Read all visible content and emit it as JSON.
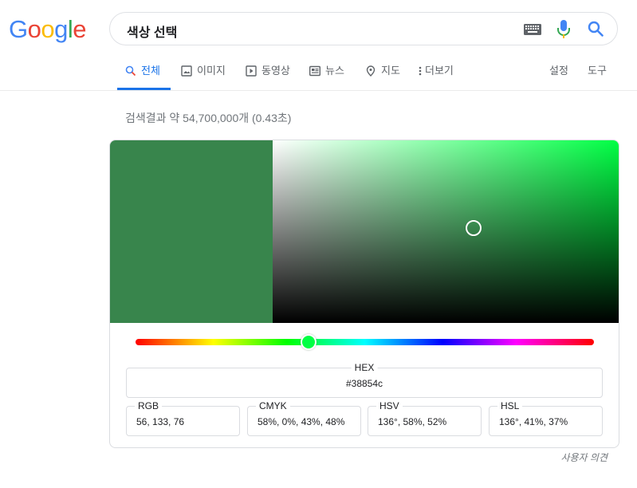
{
  "logo": {
    "letters": [
      "G",
      "o",
      "o",
      "g",
      "l",
      "e"
    ],
    "colors": [
      "#4285f4",
      "#ea4335",
      "#fbbc05",
      "#4285f4",
      "#34a853",
      "#ea4335"
    ]
  },
  "search": {
    "query": "색상 선택",
    "icons": [
      "keyboard-icon",
      "mic-icon",
      "search-icon"
    ]
  },
  "tabs": [
    {
      "label": "전체",
      "icon": "search-icon",
      "active": true
    },
    {
      "label": "이미지",
      "icon": "image-icon"
    },
    {
      "label": "동영상",
      "icon": "video-icon"
    },
    {
      "label": "뉴스",
      "icon": "news-icon"
    },
    {
      "label": "지도",
      "icon": "pin-icon"
    },
    {
      "label": "더보기",
      "icon": "more-vert-icon"
    }
  ],
  "tools": {
    "settings": "설정",
    "tools": "도구"
  },
  "result_stats": "검색결과 약 54,700,000개 (0.43초)",
  "color_picker": {
    "selected_color": "#38854c",
    "hue_color": "#00ff44",
    "hue_degrees": 136,
    "saturation": 0.58,
    "value": 0.52,
    "hex": {
      "label": "HEX",
      "value": "#38854c"
    },
    "fields": [
      {
        "label": "RGB",
        "value": "56, 133, 76"
      },
      {
        "label": "CMYK",
        "value": "58%, 0%, 43%, 48%"
      },
      {
        "label": "HSV",
        "value": "136°, 58%, 52%"
      },
      {
        "label": "HSL",
        "value": "136°, 41%, 37%"
      }
    ]
  },
  "feedback": "사용자 의견",
  "colors": {
    "accent": "#1a73e8",
    "text_secondary": "#70757a"
  }
}
